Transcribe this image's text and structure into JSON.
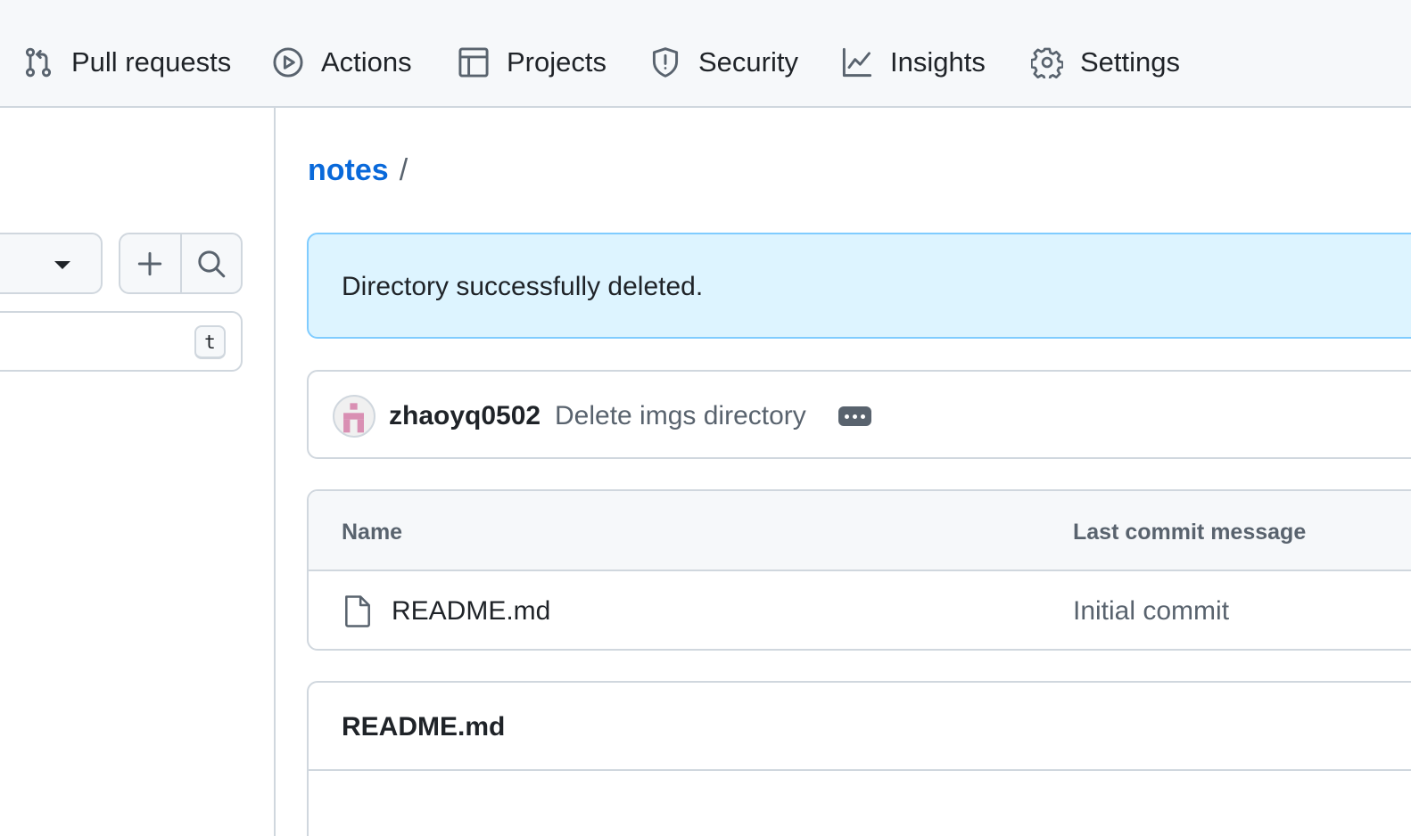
{
  "nav": {
    "items": [
      {
        "label": "Pull requests",
        "icon": "pull-request-icon"
      },
      {
        "label": "Actions",
        "icon": "play-icon"
      },
      {
        "label": "Projects",
        "icon": "table-icon"
      },
      {
        "label": "Security",
        "icon": "shield-icon"
      },
      {
        "label": "Insights",
        "icon": "graph-icon"
      },
      {
        "label": "Settings",
        "icon": "gear-icon"
      }
    ]
  },
  "sidebar": {
    "add_icon": "plus-icon",
    "search_icon": "search-icon",
    "filter_shortcut": "t"
  },
  "breadcrumb": {
    "repo": "notes",
    "separator": "/"
  },
  "flash": {
    "message": "Directory successfully deleted."
  },
  "latest_commit": {
    "author": "zhaoyq0502",
    "message": "Delete imgs directory"
  },
  "files_table": {
    "headers": {
      "name": "Name",
      "last_commit": "Last commit message"
    },
    "rows": [
      {
        "name": "README.md",
        "commit_message": "Initial commit",
        "icon": "file-icon"
      }
    ]
  },
  "readme": {
    "title": "README.md"
  },
  "colors": {
    "link": "#0969da",
    "flash_bg": "#ddf4ff",
    "flash_border": "#80ccff",
    "border": "#d0d7de",
    "muted_text": "#59636e",
    "avatar_accent": "#d98fb3"
  }
}
